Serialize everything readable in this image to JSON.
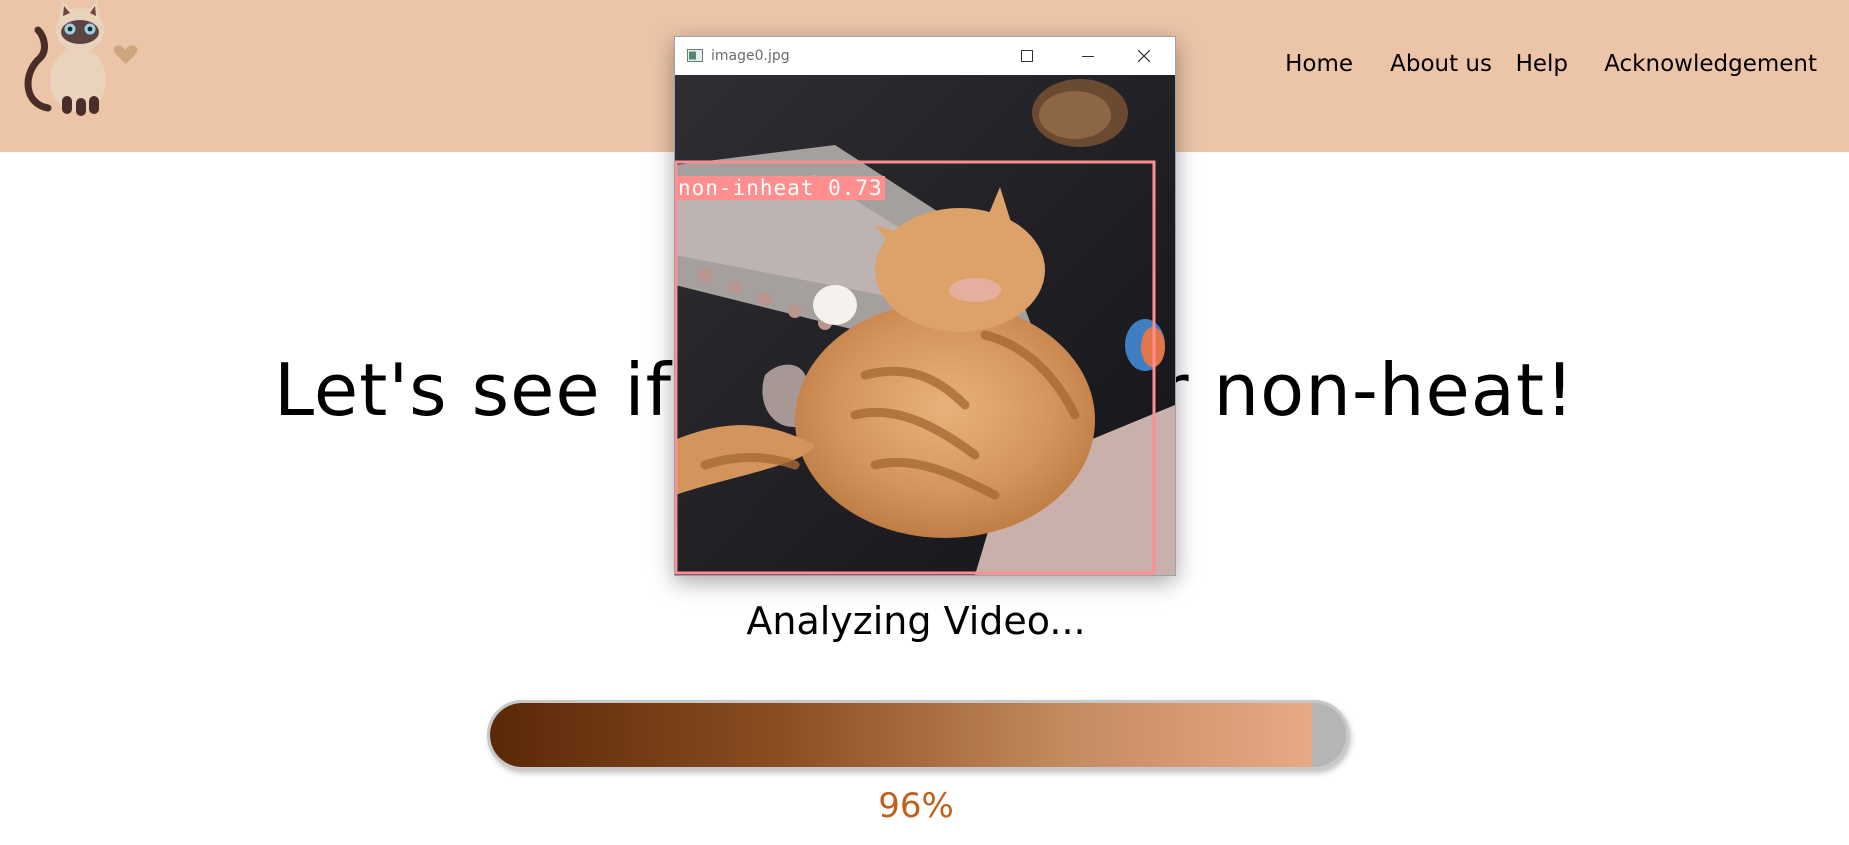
{
  "header": {
    "nav": [
      {
        "label": "Home"
      },
      {
        "label": "About us"
      },
      {
        "label": "Help"
      },
      {
        "label": "Acknowledgement"
      }
    ],
    "background_color": "#ecc5a9"
  },
  "main": {
    "headline": "Let's see if it's in-heat or non-heat!",
    "status": "Analyzing Video...",
    "progress": {
      "value_percent": 96,
      "label": "96%",
      "fill_color_start": "#5a2808",
      "fill_color_end": "#e8a987",
      "track_color": "#b5b5b5"
    },
    "percent_color": "#c0601c"
  },
  "image_window": {
    "title": "image0.jpg",
    "detection_label": "non-inheat 0.73",
    "detection_color": "#ff8f8f",
    "buttons": [
      {
        "icon": "minimize-icon"
      },
      {
        "icon": "maximize-icon"
      },
      {
        "icon": "close-icon"
      }
    ]
  }
}
